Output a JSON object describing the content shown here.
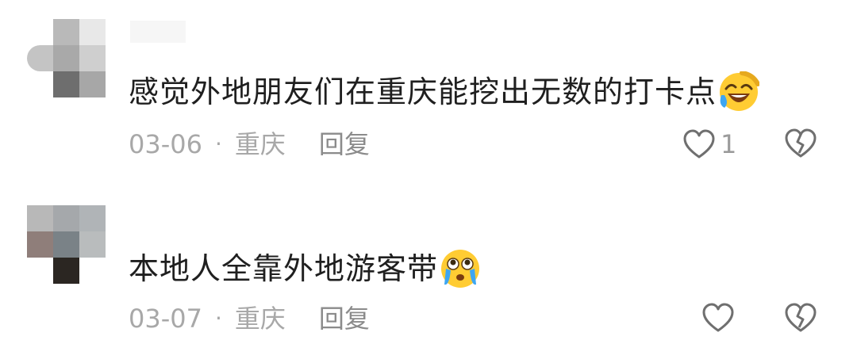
{
  "comments": [
    {
      "text": "感觉外地朋友们在重庆能挖出无数的打卡点",
      "emoji": "laughing-face-emoji",
      "date": "03-06",
      "separator": "·",
      "location": "重庆",
      "reply_label": "回复",
      "like_count": "1"
    },
    {
      "text": "本地人全靠外地游客带",
      "emoji": "crying-face-emoji",
      "date": "03-07",
      "separator": "·",
      "location": "重庆",
      "reply_label": "回复",
      "like_count": ""
    }
  ],
  "icons": {
    "like": "heart-outline-icon",
    "dislike": "broken-heart-icon"
  },
  "colors": {
    "text": "#1f1f1f",
    "meta": "#a8a8a8",
    "icon": "#6f6f6f",
    "emoji_yellow": "#ffcc33",
    "emoji_tear": "#3ea6f2"
  }
}
